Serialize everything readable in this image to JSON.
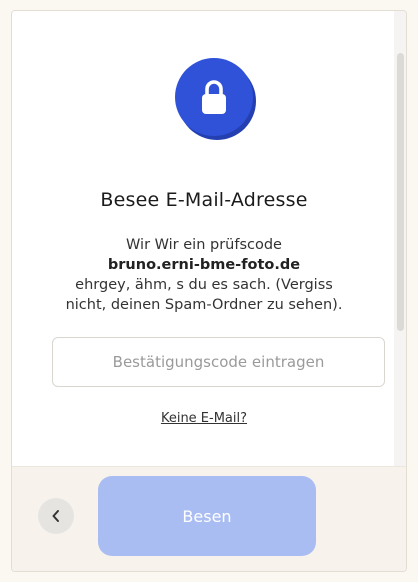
{
  "dialog": {
    "title": "Besee E-Mail-Adresse",
    "desc_line1": "Wir Wir ein prüfscode",
    "desc_email": "bruno.erni-bme-foto.de",
    "desc_line3": "ehrgey, ähm, s du es sach. (Vergiss",
    "desc_line4": "nicht, deinen Spam-Ordner zu sehen).",
    "code_input": {
      "placeholder": "Bestätigungscode eintragen",
      "value": ""
    },
    "no_mail_link": "Keine E-Mail?"
  },
  "footer": {
    "back_icon": "chevron-left-icon",
    "submit_label": "Besen"
  },
  "colors": {
    "accent": "#2f52d9",
    "submit_disabled": "#a9bdf2",
    "footer_bg": "#f7f3ec"
  }
}
